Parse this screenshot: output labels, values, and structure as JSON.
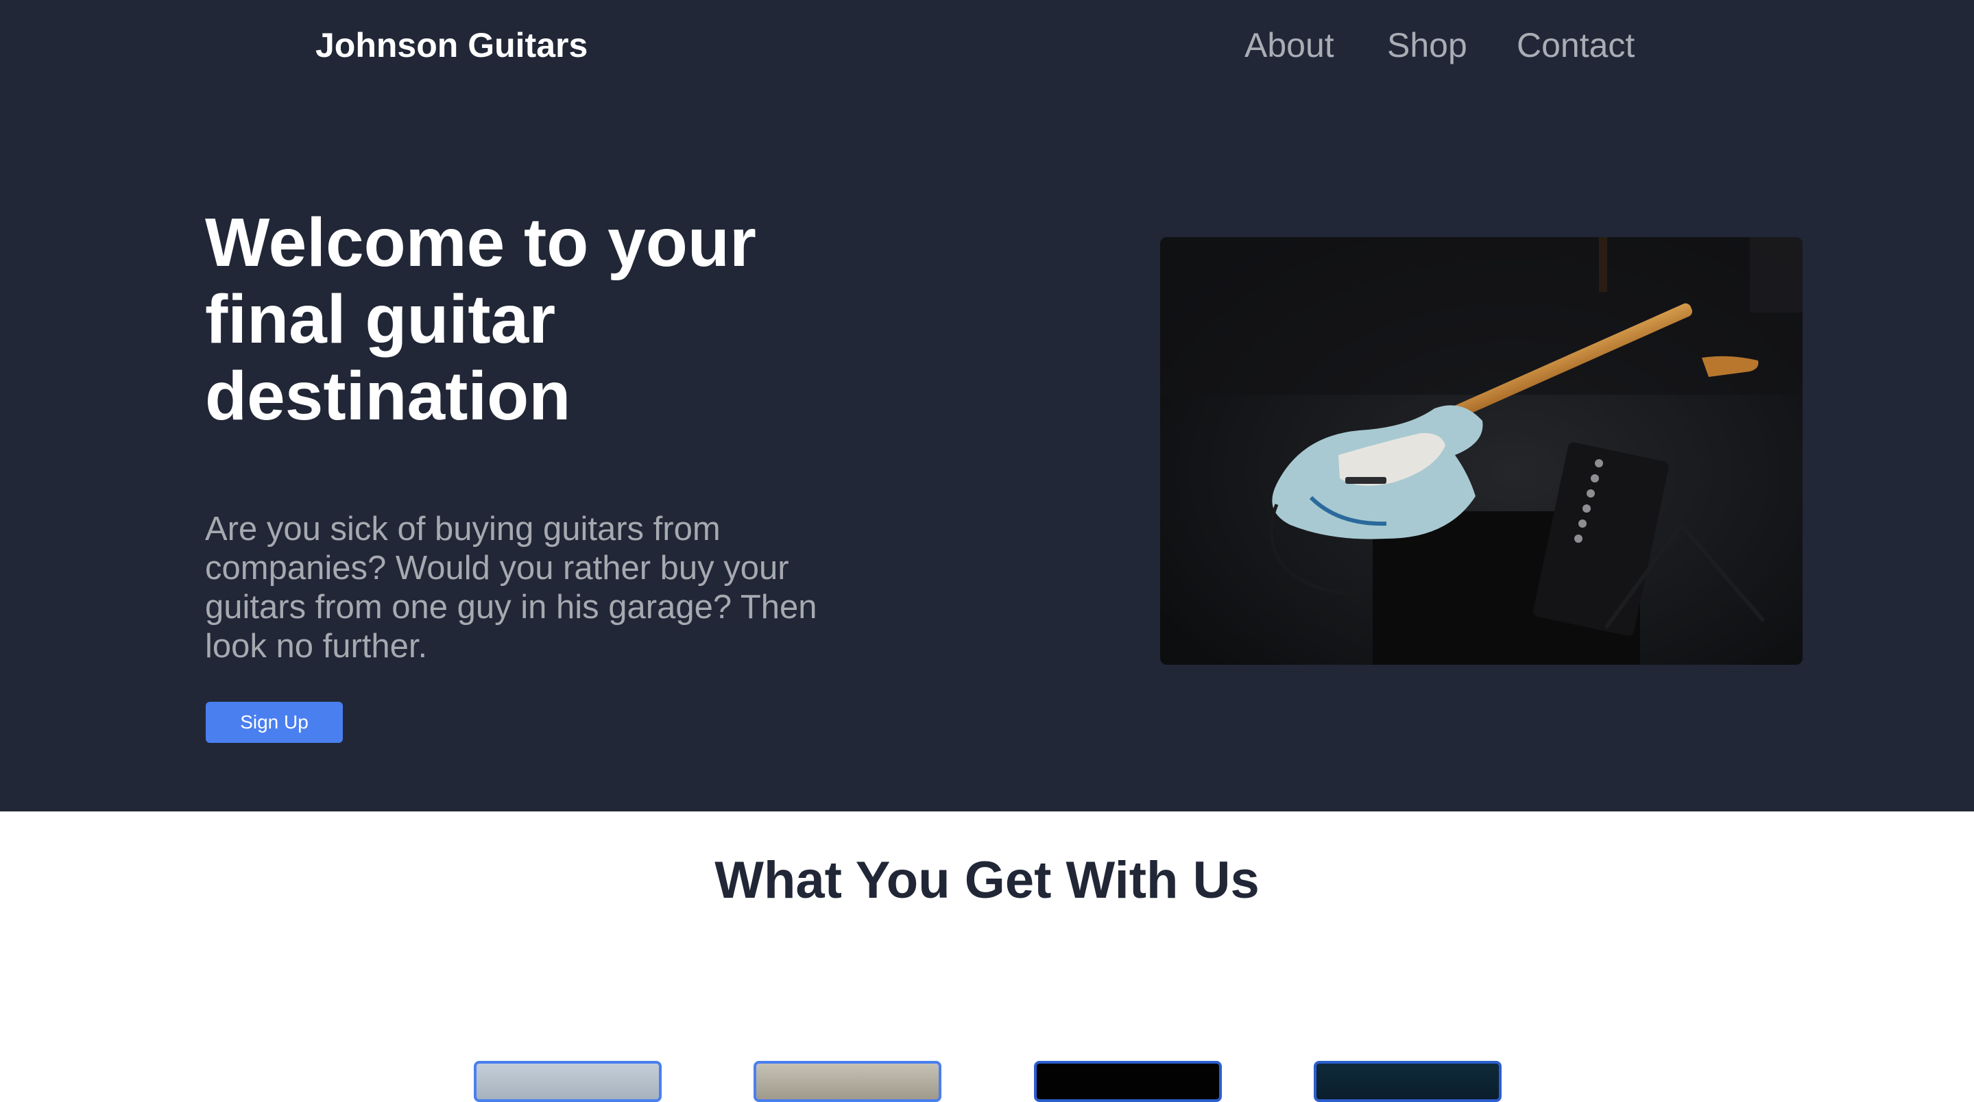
{
  "header": {
    "brand": "Johnson Guitars",
    "nav": [
      "About",
      "Shop",
      "Contact"
    ]
  },
  "hero": {
    "title": "Welcome to your final guitar destination",
    "description": "Are you sick of buying guitars from companies? Would you rather buy your guitars from one guy in his garage? Then look no further.",
    "cta_label": "Sign Up"
  },
  "features": {
    "title": "What You Get With Us"
  },
  "colors": {
    "hero_background": "#212736",
    "accent": "#4a7ff0",
    "nav_text": "#a9adb5",
    "heading_dark": "#212736"
  }
}
